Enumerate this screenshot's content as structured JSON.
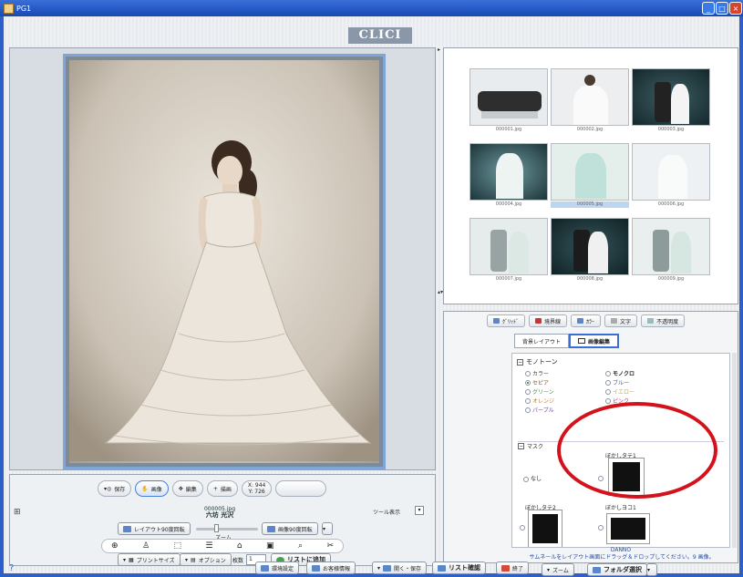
{
  "window": {
    "title": "PG1"
  },
  "logo": {
    "text": "CLICI"
  },
  "preview": {
    "file": "000005.jpg"
  },
  "thumbnails": [
    {
      "caption": "000001.jpg",
      "scene": "group",
      "selected": false
    },
    {
      "caption": "000002.jpg",
      "scene": "gown-white",
      "selected": false
    },
    {
      "caption": "000003.jpg",
      "scene": "couple-dark",
      "selected": false
    },
    {
      "caption": "000004.jpg",
      "scene": "teal-gown",
      "selected": false
    },
    {
      "caption": "000005.jpg",
      "scene": "mint-gown",
      "selected": true
    },
    {
      "caption": "000006.jpg",
      "scene": "bride-light",
      "selected": false
    },
    {
      "caption": "000007.jpg",
      "scene": "couple-light",
      "selected": false
    },
    {
      "caption": "000008.jpg",
      "scene": "couple-dark",
      "selected": false
    },
    {
      "caption": "000009.jpg",
      "scene": "couple-light",
      "selected": false
    }
  ],
  "tool_tabs": [
    {
      "label": "ｸﾞﾘｯﾄﾞ",
      "icon": "grid-icon"
    },
    {
      "label": "境界線",
      "icon": "border-icon"
    },
    {
      "label": "ｶﾗｰ",
      "icon": "color-icon"
    },
    {
      "label": "文字",
      "icon": "text-icon"
    },
    {
      "label": "不透明度",
      "icon": "opacity-icon"
    }
  ],
  "subtabs": [
    {
      "label": "背景レイアウト",
      "active": false
    },
    {
      "label": "画像編集",
      "active": true
    }
  ],
  "monotone": {
    "title": "モノトーン",
    "options": [
      {
        "label": "カラー",
        "checked": false,
        "color": "#444444"
      },
      {
        "label": "モノクロ",
        "checked": false,
        "color": "#222222"
      },
      {
        "label": "セピア",
        "checked": true,
        "color": "#7a5a2a"
      },
      {
        "label": "ブルー",
        "checked": false,
        "color": "#3b62c7"
      },
      {
        "label": "グリーン",
        "checked": false,
        "color": "#3a9a3a"
      },
      {
        "label": "イエロー",
        "checked": false,
        "color": "#d3a800"
      },
      {
        "label": "オレンジ",
        "checked": false,
        "color": "#e07a00"
      },
      {
        "label": "ピンク",
        "checked": false,
        "color": "#d0308a"
      },
      {
        "label": "パープル",
        "checked": false,
        "color": "#7a3fb0"
      }
    ]
  },
  "mask": {
    "title": "マスク",
    "none_label": "なし",
    "items": [
      "ぼかしタテ1",
      "ぼかしタテ2",
      "ぼかしヨコ1"
    ]
  },
  "preview_controls": {
    "pills": [
      "保存",
      "画像",
      "編集",
      "描画"
    ],
    "coords": {
      "x": "X: 944",
      "y": "Y: 726"
    }
  },
  "caption": {
    "file": "000005.jpg",
    "name": "六坊 光沢"
  },
  "tool_toggle": {
    "label": "ツール表示"
  },
  "rotate": {
    "left": "レイアウト90度回転",
    "zoom": "ズーム",
    "right": "画像90度回転"
  },
  "print": {
    "size_label": "プリントサイズ",
    "option_label": "オプション",
    "count_label": "枚数",
    "count_value": "1",
    "add_label": "リストに追加"
  },
  "thumbs_footer": {
    "folder": "DANNO",
    "hint": "サムネールをレイアウト画面にドラッグ＆ドロップしてください。9 画像。",
    "zoom_label": "ズーム",
    "folder_select_label": "フォルダ選択"
  },
  "bottom": {
    "buttons": [
      "環境設定",
      "お客様情報",
      "開く・保存",
      "リスト確認",
      "終了"
    ]
  }
}
